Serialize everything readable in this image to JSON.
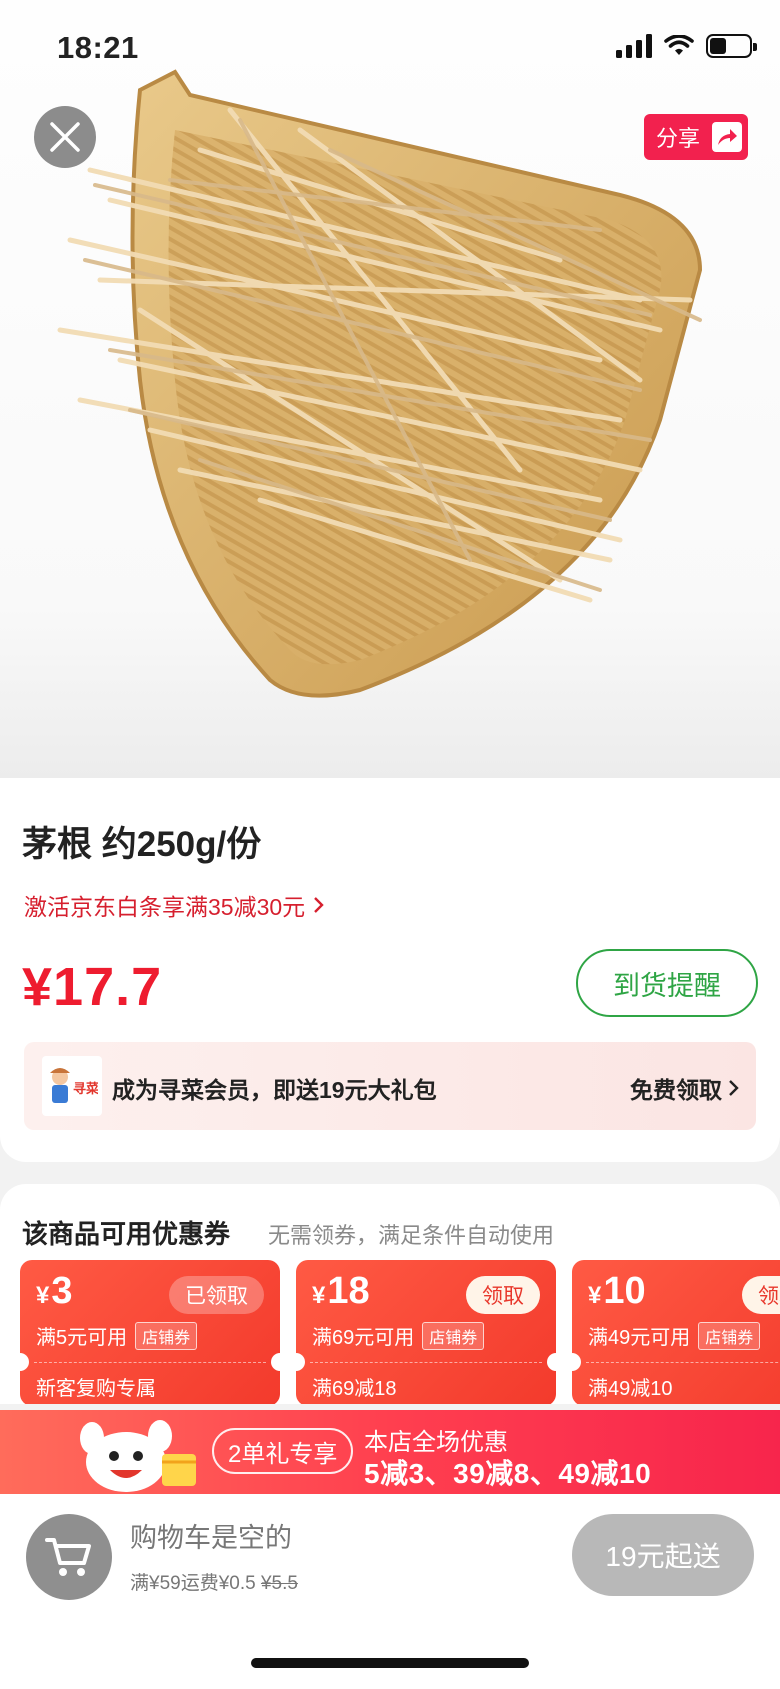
{
  "status_bar": {
    "time": "18:21"
  },
  "hero": {
    "share_label": "分享"
  },
  "product": {
    "title": "茅根  约250g/份",
    "promo": "激活京东白条享满35减30元",
    "price": "¥17.7",
    "notify_label": "到货提醒"
  },
  "member": {
    "logo_text": "寻菜",
    "text": "成为寻菜会员，即送19元大礼包",
    "claim": "免费领取"
  },
  "coupons": {
    "heading": "该商品可用优惠券",
    "subtitle": "无需领券，满足条件自动使用",
    "items": [
      {
        "yen": "¥",
        "amount": "3",
        "tag": "已领取",
        "condition": "满5元可用",
        "type": "店铺券",
        "note": "新客复购专属"
      },
      {
        "yen": "¥",
        "amount": "18",
        "tag": "领取",
        "condition": "满69元可用",
        "type": "店铺券",
        "note": "满69减18"
      },
      {
        "yen": "¥",
        "amount": "10",
        "tag": "领取",
        "condition": "满49元可用",
        "type": "店铺券",
        "note": "满49减10"
      }
    ]
  },
  "store_promo": {
    "badge": "2单礼专享",
    "title": "本店全场优惠",
    "deals": "5减3、39减8、49减10"
  },
  "cart": {
    "empty_text": "购物车是空的",
    "shipping_prefix": "满¥59运费¥0.5",
    "shipping_original": "¥5.5",
    "start_label": "19元起送"
  },
  "colors": {
    "price_red": "#ee1c2f",
    "notify_green": "#2fa545",
    "share_pink": "#f2214e",
    "coupon_red": "#f33a2c"
  }
}
